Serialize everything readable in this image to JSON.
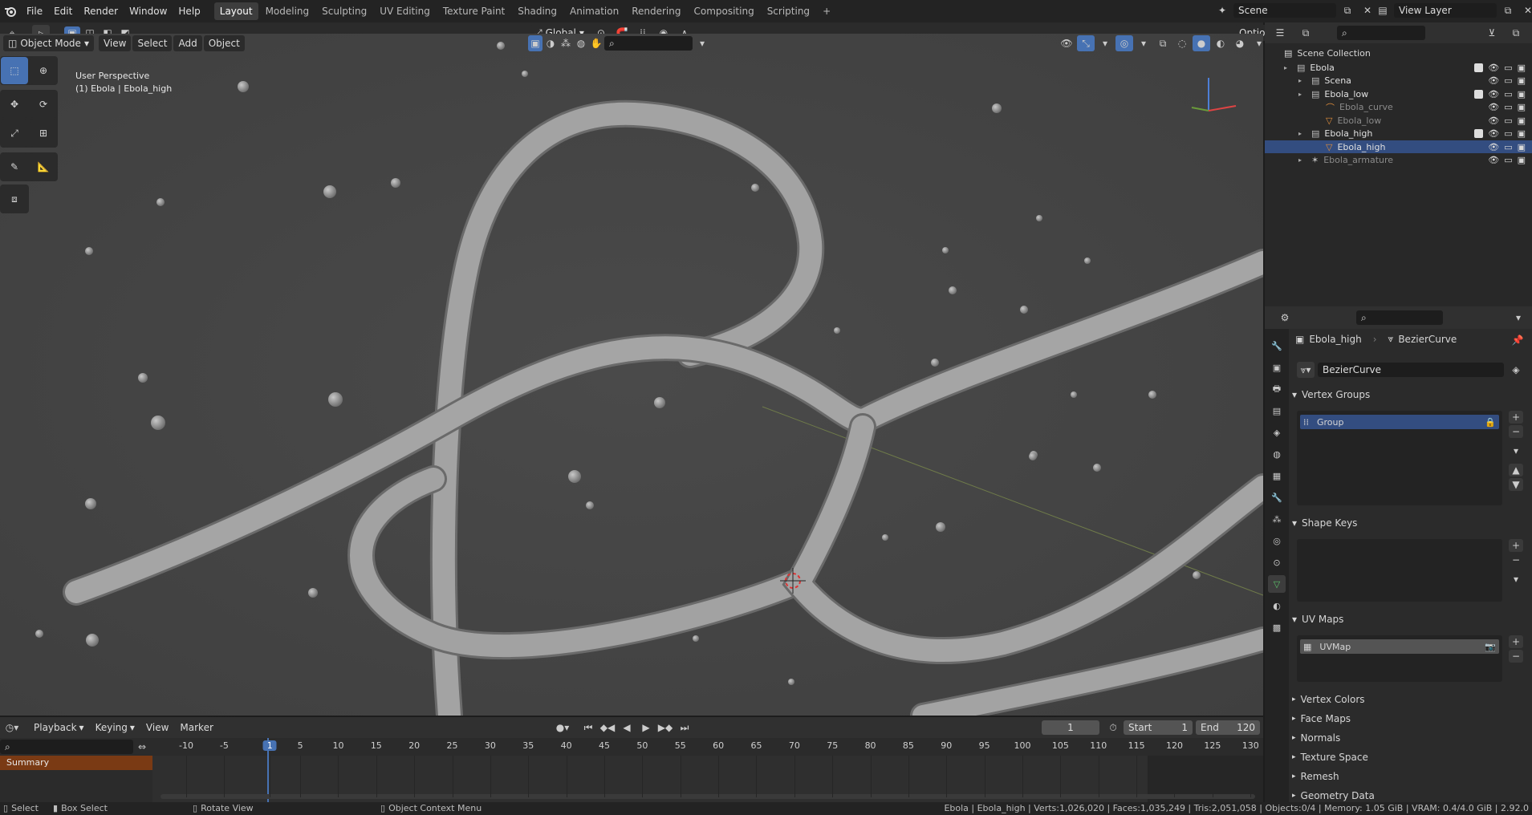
{
  "topbar": {
    "menus": [
      "File",
      "Edit",
      "Render",
      "Window",
      "Help"
    ],
    "workspaces": [
      "Layout",
      "Modeling",
      "Sculpting",
      "UV Editing",
      "Texture Paint",
      "Shading",
      "Animation",
      "Rendering",
      "Compositing",
      "Scripting"
    ],
    "active_workspace": "Layout",
    "add_tab": "+",
    "scene": "Scene",
    "view_layer": "View Layer"
  },
  "viewport_header": {
    "mode": "Object Mode",
    "menus": [
      "View",
      "Select",
      "Add",
      "Object"
    ],
    "transform_orientation": "Global",
    "options": "Options"
  },
  "viewport": {
    "perspective": "User Perspective",
    "object_info": "(1) Ebola | Ebola_high"
  },
  "outliner": {
    "root": "Scene Collection",
    "rows": [
      {
        "name": "Ebola",
        "indent": 0
      },
      {
        "name": "Scena",
        "indent": 1
      },
      {
        "name": "Ebola_low",
        "indent": 1
      },
      {
        "name": "Ebola_curve",
        "indent": 2,
        "dim": true
      },
      {
        "name": "Ebola_low",
        "indent": 2,
        "dim": true
      },
      {
        "name": "Ebola_high",
        "indent": 1
      },
      {
        "name": "Ebola_high",
        "indent": 2
      },
      {
        "name": "Ebola_armature",
        "indent": 1,
        "dim": true
      }
    ]
  },
  "properties": {
    "breadcrumb_object": "Ebola_high",
    "breadcrumb_data": "BezierCurve",
    "data_name": "BezierCurve",
    "vertex_groups_title": "Vertex Groups",
    "vertex_group_item": "Group",
    "shape_keys_title": "Shape Keys",
    "uv_maps_title": "UV Maps",
    "uv_map_item": "UVMap",
    "collapsed_panels": [
      "Vertex Colors",
      "Face Maps",
      "Normals",
      "Texture Space",
      "Remesh",
      "Geometry Data"
    ]
  },
  "timeline": {
    "menus": [
      "Playback",
      "Keying",
      "View",
      "Marker"
    ],
    "current_frame": "1",
    "start_label": "Start",
    "start_value": "1",
    "end_label": "End",
    "end_value": "120",
    "summary": "Summary",
    "ticks": [
      "-10",
      "-5",
      "1",
      "5",
      "10",
      "15",
      "20",
      "25",
      "30",
      "35",
      "40",
      "45",
      "50",
      "55",
      "60",
      "65",
      "70",
      "75",
      "80",
      "85",
      "90",
      "95",
      "100",
      "105",
      "110",
      "115",
      "120",
      "125",
      "130"
    ]
  },
  "statusbar": {
    "select": "Select",
    "box_select": "Box Select",
    "rotate_view": "Rotate View",
    "context_menu": "Object Context Menu",
    "stats": "Ebola | Ebola_high | Verts:1,026,020 | Faces:1,035,249 | Tris:2,051,058 | Objects:0/4 | Memory: 1.05 GiB | VRAM: 0.4/4.0 GiB | 2.92.0"
  },
  "colors": {
    "accent": "#4772b3",
    "selected_row": "#334d80",
    "viewport_bg": "#444444",
    "mesh": "#9e9e9e"
  }
}
